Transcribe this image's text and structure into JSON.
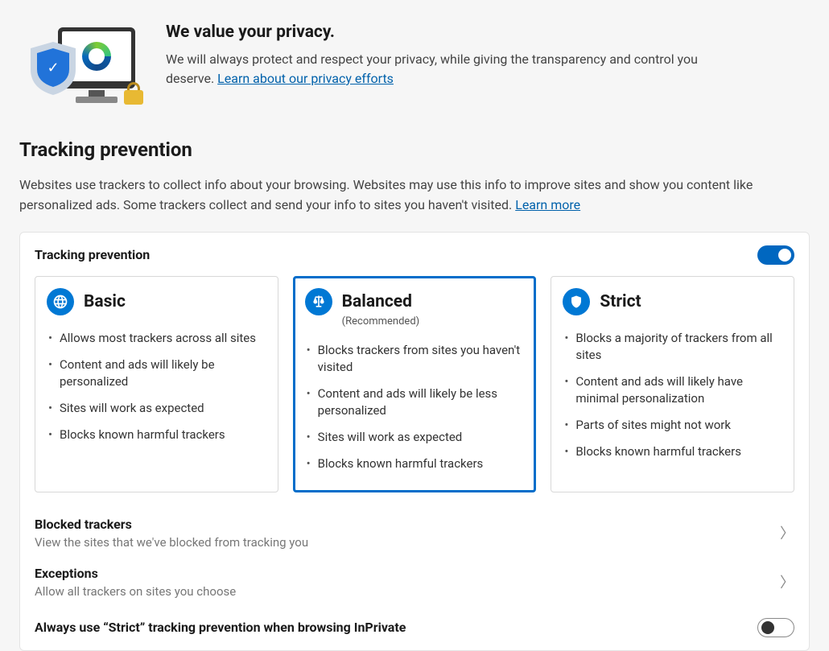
{
  "header": {
    "title": "We value your privacy.",
    "description": "We will always protect and respect your privacy, while giving the transparency and control you deserve. ",
    "link": "Learn about our privacy efforts"
  },
  "section": {
    "title": "Tracking prevention",
    "description": "Websites use trackers to collect info about your browsing. Websites may use this info to improve sites and show you content like personalized ads. Some trackers collect and send your info to sites you haven't visited. ",
    "learn_more": "Learn more"
  },
  "card": {
    "title": "Tracking prevention",
    "toggle_on": true,
    "options": [
      {
        "name": "Basic",
        "subtitle": "",
        "selected": false,
        "icon": "earth-icon",
        "bullets": [
          "Allows most trackers across all sites",
          "Content and ads will likely be personalized",
          "Sites will work as expected",
          "Blocks known harmful trackers"
        ]
      },
      {
        "name": "Balanced",
        "subtitle": "(Recommended)",
        "selected": true,
        "icon": "balance-scale-icon",
        "bullets": [
          "Blocks trackers from sites you haven't visited",
          "Content and ads will likely be less personalized",
          "Sites will work as expected",
          "Blocks known harmful trackers"
        ]
      },
      {
        "name": "Strict",
        "subtitle": "",
        "selected": false,
        "icon": "shield-icon",
        "bullets": [
          "Blocks a majority of trackers from all sites",
          "Content and ads will likely have minimal personalization",
          "Parts of sites might not work",
          "Blocks known harmful trackers"
        ]
      }
    ],
    "sub_rows": [
      {
        "title": "Blocked trackers",
        "desc": "View the sites that we've blocked from tracking you"
      },
      {
        "title": "Exceptions",
        "desc": "Allow all trackers on sites you choose"
      }
    ],
    "inprivate": {
      "label": "Always use “Strict” tracking prevention when browsing InPrivate",
      "toggle_on": false
    }
  }
}
